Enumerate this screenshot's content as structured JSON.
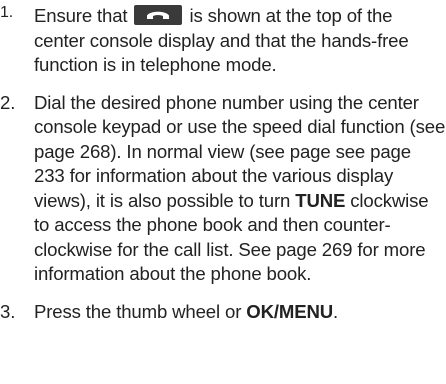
{
  "icons": {
    "phone": "phone-handset-icon"
  },
  "colors": {
    "text": "#222222",
    "icon_background": "#3a3a3a",
    "icon_glyph": "#ffffff"
  },
  "steps": [
    {
      "number": "1.",
      "text_before_icon": "Ensure that",
      "text_after_icon": "is shown at the top of the center console display and that the hands-free function is in telephone mode."
    },
    {
      "number": "2.",
      "text_1": "Dial the desired phone number using the center console keypad or use the speed dial function (see page 268). In normal view (see page see page 233 for information about the various display views), it is also possible to turn",
      "bold_1": "TUNE",
      "text_2": "clockwise to access the phone book and then counter-clockwise for the call list. See page 269 for more information about the phone book."
    },
    {
      "number": "3.",
      "text_1": "Press the thumb wheel or",
      "bold_1": "OK/MENU",
      "text_2": "."
    }
  ]
}
